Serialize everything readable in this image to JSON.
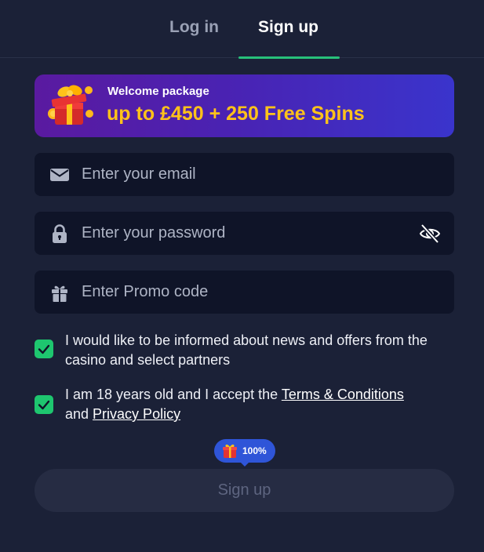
{
  "tabs": {
    "login_label": "Log in",
    "signup_label": "Sign up",
    "active": "signup"
  },
  "banner": {
    "small_text": "Welcome package",
    "big_text": "up to £450 + 250 Free Spins",
    "icon": "gift-box-icon"
  },
  "form": {
    "email": {
      "placeholder": "Enter your email",
      "value": "",
      "icon": "envelope-icon"
    },
    "password": {
      "placeholder": "Enter your password",
      "value": "",
      "icon": "lock-icon",
      "toggle_icon": "eye-off-icon"
    },
    "promo": {
      "placeholder": "Enter Promo code",
      "value": "",
      "icon": "gift-icon"
    }
  },
  "consents": {
    "news": {
      "checked": true,
      "text": "I would like to be informed about news and offers from the casino and select partners"
    },
    "terms": {
      "checked": true,
      "text_before": "I am 18 years old and I accept the ",
      "terms_link": "Terms & Conditions",
      "text_middle": "and ",
      "privacy_link": "Privacy Policy"
    }
  },
  "badge": {
    "text": "100%",
    "icon": "gift-icon"
  },
  "submit": {
    "label": "Sign up",
    "enabled": false
  },
  "colors": {
    "background": "#1b2137",
    "input_bg": "#0f1428",
    "accent_green": "#27c07a",
    "banner_yellow": "#ffc21a",
    "badge_blue": "#2f55d8"
  }
}
